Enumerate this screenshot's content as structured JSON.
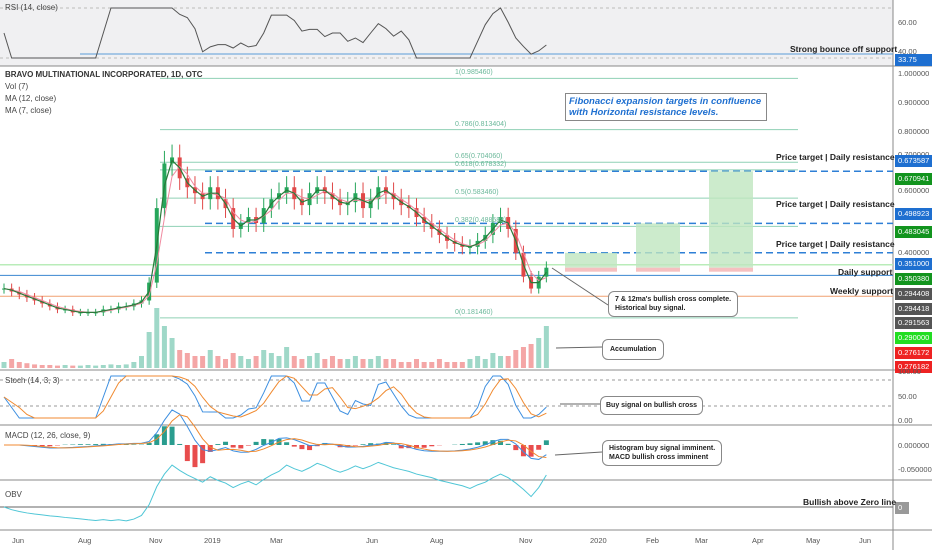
{
  "header": {
    "symbol": "BRAVO MULTINATIONAL INCORPORATED, 1D, OTC",
    "studies": [
      "Vol (7)",
      "MA (12, close)",
      "MA (7, close)"
    ]
  },
  "rsi": {
    "label": "RSI (14, close)",
    "note": "Strong bounce off support",
    "ticks": [
      "60.00",
      "40.00"
    ],
    "tag": "33.75"
  },
  "stoch": {
    "label": "Stoch (14, 3, 3)",
    "ticks": [
      "100.00",
      "50.00",
      "0.00"
    ]
  },
  "macd": {
    "label": "MACD (12, 26, close, 9)",
    "ticks": [
      "0.000000",
      "-0.050000"
    ]
  },
  "obv": {
    "label": "OBV",
    "tag": "0",
    "note": "Bullish above Zero line"
  },
  "price_ticks": [
    "1.000000",
    "0.900000",
    "0.800000",
    "0.700000",
    "0.600000",
    "0.400000"
  ],
  "price_tags": [
    {
      "text": "0.673587",
      "color": "#1e6fd0",
      "price": 0.6736
    },
    {
      "text": "0.670941",
      "color": "#12941e",
      "price": 0.6709
    },
    {
      "text": "0.498923",
      "color": "#1e6fd0",
      "price": 0.4989
    },
    {
      "text": "0.483045",
      "color": "#12941e",
      "price": 0.483
    },
    {
      "text": "0.351000",
      "color": "#1e6fd0",
      "price": 0.351
    },
    {
      "text": "0.350380",
      "color": "#12941e",
      "price": 0.3504
    },
    {
      "text": "0.294408",
      "color": "#555555",
      "price": 0.2944
    },
    {
      "text": "0.294418",
      "color": "#555555",
      "price": 0.2944
    },
    {
      "text": "0.291563",
      "color": "#555555",
      "price": 0.2916
    },
    {
      "text": "0.290000",
      "color": "#22dd22",
      "price": 0.29
    },
    {
      "text": "0.276172",
      "color": "#ee2222",
      "price": 0.2762
    },
    {
      "text": "0.276182",
      "color": "#ee2222",
      "price": 0.2762
    }
  ],
  "fib_levels": [
    {
      "text": "1(0.985460)",
      "price": 0.98546
    },
    {
      "text": "0.786(0.813404)",
      "price": 0.813404
    },
    {
      "text": "0.65(0.704060)",
      "price": 0.70406
    },
    {
      "text": "0.618(0.678332)",
      "price": 0.678332
    },
    {
      "text": "0.5(0.583460)",
      "price": 0.58346
    },
    {
      "text": "0.382(0.488588)",
      "price": 0.488588
    },
    {
      "text": "0(0.181460)",
      "price": 0.18146
    }
  ],
  "annotations": {
    "fib_box": [
      "Fibonacci expansion targets in confluence",
      "with Horizontal resistance levels."
    ],
    "targets": [
      "Price target | Daily resistance",
      "Price target | Daily resistance",
      "Price target | Daily resistance"
    ],
    "daily_support": "Daily support",
    "weekly_support": "Weekly support",
    "ma_cross": [
      "7 & 12ma's bullish cross complete.",
      "Historical buy signal."
    ],
    "accumulation": "Accumulation",
    "stoch_cross": "Buy signal on bullish cross",
    "macd_note": [
      "Histogram buy signal imminent.",
      "MACD bullish cross imminent"
    ]
  },
  "time_axis": [
    "Jun",
    "Aug",
    "Nov",
    "2019",
    "Mar",
    "Jun",
    "Aug",
    "Nov",
    "2020",
    "Feb",
    "Mar",
    "Apr",
    "May",
    "Jun"
  ],
  "chart_data": {
    "type": "candlestick",
    "title": "BRAVO MULTINATIONAL INCORPORATED, 1D, OTC",
    "x_range": [
      "2018-06",
      "2020-06"
    ],
    "ylim": [
      0.15,
      1.05
    ],
    "resistance_levels": [
      0.673587,
      0.498923,
      0.4
    ],
    "support_levels": {
      "daily": 0.351,
      "weekly": 0.294408
    },
    "weekly_close": [
      0.28,
      0.27,
      0.26,
      0.25,
      0.24,
      0.23,
      0.22,
      0.21,
      0.21,
      0.2,
      0.2,
      0.2,
      0.2,
      0.21,
      0.21,
      0.22,
      0.22,
      0.23,
      0.24,
      0.3,
      0.55,
      0.7,
      0.72,
      0.65,
      0.62,
      0.6,
      0.58,
      0.62,
      0.58,
      0.55,
      0.48,
      0.5,
      0.52,
      0.5,
      0.55,
      0.58,
      0.6,
      0.62,
      0.58,
      0.56,
      0.6,
      0.62,
      0.6,
      0.58,
      0.56,
      0.57,
      0.6,
      0.55,
      0.58,
      0.62,
      0.6,
      0.58,
      0.56,
      0.55,
      0.52,
      0.5,
      0.48,
      0.46,
      0.44,
      0.43,
      0.42,
      0.42,
      0.44,
      0.46,
      0.5,
      0.52,
      0.48,
      0.4,
      0.32,
      0.28,
      0.32,
      0.35
    ],
    "volume_relative": [
      0.1,
      0.15,
      0.1,
      0.08,
      0.06,
      0.05,
      0.05,
      0.04,
      0.05,
      0.04,
      0.04,
      0.05,
      0.04,
      0.05,
      0.06,
      0.05,
      0.06,
      0.1,
      0.2,
      0.6,
      1.0,
      0.7,
      0.5,
      0.3,
      0.25,
      0.2,
      0.2,
      0.3,
      0.2,
      0.15,
      0.25,
      0.2,
      0.15,
      0.2,
      0.3,
      0.25,
      0.2,
      0.35,
      0.2,
      0.15,
      0.2,
      0.25,
      0.15,
      0.2,
      0.15,
      0.15,
      0.2,
      0.15,
      0.15,
      0.2,
      0.15,
      0.15,
      0.1,
      0.1,
      0.15,
      0.1,
      0.1,
      0.15,
      0.1,
      0.1,
      0.1,
      0.15,
      0.2,
      0.15,
      0.25,
      0.2,
      0.2,
      0.3,
      0.35,
      0.4,
      0.5,
      0.7
    ],
    "target_boxes": [
      {
        "from": 0.35,
        "to": 0.4
      },
      {
        "from": 0.35,
        "to": 0.4989
      },
      {
        "from": 0.35,
        "to": 0.6736
      }
    ]
  }
}
